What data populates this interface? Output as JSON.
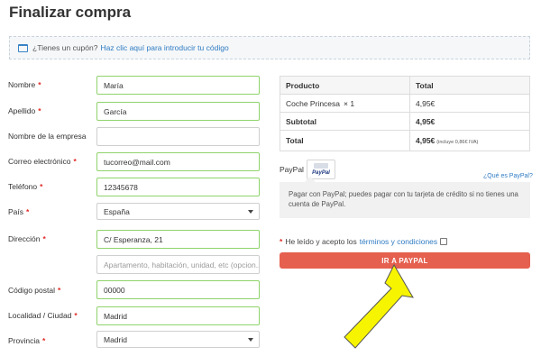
{
  "page": {
    "title": "Finalizar compra"
  },
  "coupon": {
    "question": "¿Tienes un cupón?",
    "link": "Haz clic aquí para introducir tu código"
  },
  "form": {
    "nombre": {
      "label": "Nombre",
      "required": "*",
      "value": "María"
    },
    "apellido": {
      "label": "Apellido",
      "required": "*",
      "value": "García"
    },
    "empresa": {
      "label": "Nombre de la empresa",
      "value": ""
    },
    "email": {
      "label": "Correo electrónico",
      "required": "*",
      "value": "tucorreo@mail.com"
    },
    "telefono": {
      "label": "Teléfono",
      "required": "*",
      "value": "12345678"
    },
    "pais": {
      "label": "País",
      "required": "*",
      "value": "España"
    },
    "direccion": {
      "label": "Dirección",
      "required": "*",
      "value": "C/ Esperanza, 21",
      "placeholder2": "Apartamento, habitación, unidad, etc (opcion..."
    },
    "cp": {
      "label": "Código postal",
      "required": "*",
      "value": "00000"
    },
    "localidad": {
      "label": "Localidad / Ciudad",
      "required": "*",
      "value": "Madrid"
    },
    "provincia": {
      "label": "Provincia",
      "required": "*",
      "value": "Madrid"
    }
  },
  "order": {
    "headers": {
      "product": "Producto",
      "total": "Total"
    },
    "item": {
      "name": "Coche Princesa",
      "qty": "× 1",
      "price": "4,95€"
    },
    "subtotal": {
      "label": "Subtotal",
      "value": "4,95€"
    },
    "total": {
      "label": "Total",
      "value": "4,95€",
      "tax_note": "(incluye 0,86€ IVA)"
    }
  },
  "payment": {
    "method_label": "PayPal",
    "logo_text": "PayPal",
    "what_link": "¿Qué es PayPal?",
    "description": "Pagar con PayPal; puedes pagar con tu tarjeta de crédito si no tienes una cuenta de PayPal."
  },
  "terms": {
    "required": "*",
    "text": "He leído y acepto los",
    "link": "términos y condiciones"
  },
  "button": {
    "label": "IR A PAYPAL"
  },
  "colors": {
    "accent": "#e5604f",
    "link": "#2f7cc3",
    "valid_border": "#8fd36c",
    "arrow": "#f7f400"
  }
}
